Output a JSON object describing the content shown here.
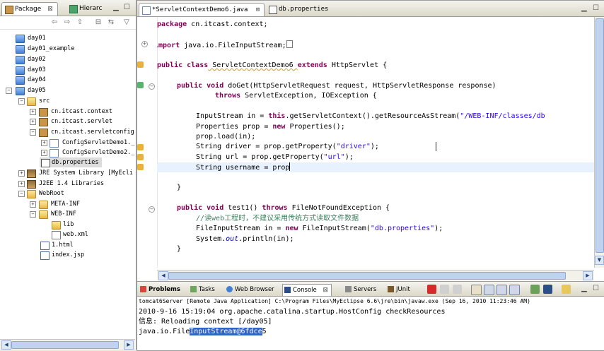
{
  "left_panel": {
    "tabs": [
      {
        "label": "Package",
        "close": "⊠"
      },
      {
        "label": "Hierarc"
      }
    ],
    "tree": [
      {
        "label": "day01",
        "icon": "folder-icon"
      },
      {
        "label": "day01_example",
        "icon": "folder-icon"
      },
      {
        "label": "day02",
        "icon": "folder-icon"
      },
      {
        "label": "day03",
        "icon": "folder-icon"
      },
      {
        "label": "day04",
        "icon": "folder-icon"
      },
      {
        "label": "day05",
        "icon": "project-icon"
      },
      {
        "label": "src",
        "icon": "source-folder-icon"
      },
      {
        "label": "cn.itcast.context",
        "icon": "package-icon"
      },
      {
        "label": "cn.itcast.servlet",
        "icon": "package-icon"
      },
      {
        "label": "cn.itcast.servletconfig",
        "icon": "package-icon"
      },
      {
        "label": "ConfigServletDemo1._",
        "icon": "java-file-icon"
      },
      {
        "label": "ConfigServletDemo2._",
        "icon": "java-file-icon"
      },
      {
        "label": "db.properties",
        "icon": "properties-file-icon"
      },
      {
        "label": "JRE System Library [MyEcli",
        "icon": "library-icon"
      },
      {
        "label": "J2EE 1.4 Libraries",
        "icon": "library-icon"
      },
      {
        "label": "WebRoot",
        "icon": "folder-icon"
      },
      {
        "label": "META-INF",
        "icon": "folder-icon"
      },
      {
        "label": "WEB-INF",
        "icon": "folder-icon"
      },
      {
        "label": "lib",
        "icon": "folder-icon"
      },
      {
        "label": "web.xml",
        "icon": "xml-file-icon"
      },
      {
        "label": "1.html",
        "icon": "html-file-icon"
      },
      {
        "label": "index.jsp",
        "icon": "jsp-file-icon"
      }
    ]
  },
  "editor": {
    "tabs": [
      {
        "label": "*ServletContextDemo6.java",
        "close": "⊠"
      },
      {
        "label": "db.properties"
      }
    ]
  },
  "code_tokens": {
    "l1": [
      "package",
      " cn.itcast.context;"
    ],
    "l2": [
      "import",
      " java.io.FileInputStream;"
    ],
    "l3": [
      "public class",
      " ServletContextDemo6 ",
      "extends",
      " HttpServlet {"
    ],
    "l4": [
      "public void",
      " doGet(HttpServletRequest request, HttpServletResponse response)"
    ],
    "l5": [
      "throws",
      " ServletException, IOException {"
    ],
    "l6": [
      "InputStream in = ",
      "this",
      ".getServletContext().getResourceAsStream(",
      "\"/WEB-INF/classes/db"
    ],
    "l7": [
      "Properties prop = ",
      "new",
      " Properties();"
    ],
    "l8": [
      "prop.load(in);"
    ],
    "l9": [
      "String driver = prop.getProperty(",
      "\"driver\"",
      ");"
    ],
    "l10": [
      "String url = prop.getProperty(",
      "\"url\"",
      ");"
    ],
    "l11": [
      "String username = prop"
    ],
    "l12": [
      "}"
    ],
    "l13": [
      "public void",
      " test1() ",
      "throws",
      " FileNotFoundException {"
    ],
    "l14": [
      "//读web工程时，不建议采用传统方式读取文件数据"
    ],
    "l15": [
      "FileInputStream in = ",
      "new",
      " FileInputStream(",
      "\"db.properties\"",
      ");"
    ],
    "l16": [
      "System.",
      "out",
      ".println(in);"
    ],
    "l17": [
      "}"
    ]
  },
  "console": {
    "tabs": [
      "Problems",
      "Tasks",
      "Web Browser",
      "Console",
      "Servers",
      "JUnit"
    ],
    "info_line": "tomcat6Server [Remote Java Application] C:\\Program Files\\MyEclipse 6.6\\jre\\bin\\javaw.exe (Sep 16, 2010 11:23:46 AM)",
    "lines": [
      "2010-9-16 15:19:04 org.apache.catalina.startup.HostConfig checkResources",
      "信息: Reloading context [/day05]"
    ],
    "last_line_prefix": "java.io.File",
    "last_line_selected": "InputStream@6fdce",
    "last_line_suffix": "5"
  },
  "colors": {
    "keyword": "#7f0055",
    "string": "#2a00ff",
    "comment": "#3f7f5f",
    "selection": "#3163c5"
  }
}
